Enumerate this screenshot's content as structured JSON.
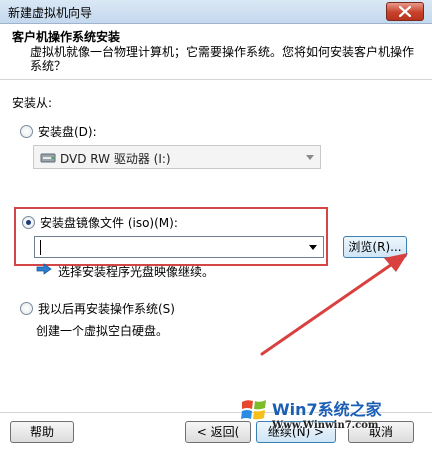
{
  "window": {
    "title": "新建虚拟机向导",
    "close_icon": "close-icon"
  },
  "header": {
    "title": "客户机操作系统安装",
    "subtitle": "虚拟机就像一台物理计算机；它需要操作系统。您将如何安装客户机操作系统？"
  },
  "install_from": {
    "label": "安装从:",
    "option_disc": {
      "label": "安装盘(D):",
      "selected": false,
      "drive_value": "DVD RW 驱动器 (I:)",
      "drive_icon": "dvd-drive-icon"
    },
    "option_iso": {
      "label": "安装盘镜像文件 (iso)(M):",
      "selected": true,
      "path_value": "",
      "browse_label": "浏览(R)...",
      "hint": "选择安装程序光盘映像继续。",
      "hint_icon": "blue-arrow-right-icon"
    },
    "option_later": {
      "label": "我以后再安装操作系统(S)",
      "selected": false,
      "description": "创建一个虚拟空白硬盘。"
    }
  },
  "footer": {
    "help_label": "帮助",
    "back_label": "< 返回(",
    "next_label": "继续(N) >",
    "cancel_label": "取消"
  },
  "watermark": {
    "brand": "Win7系统之家",
    "url": "Www.Winwin7.com"
  },
  "colors": {
    "highlight_box": "#d64545",
    "annotation_arrow": "#d94040",
    "accent_button_border": "#3c7fb1"
  }
}
